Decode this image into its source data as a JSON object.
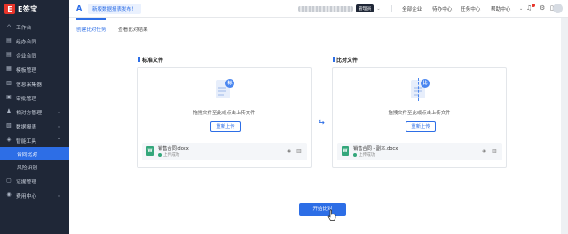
{
  "brand": {
    "logo_mark": "E",
    "name": "E签宝"
  },
  "sidebar": {
    "items": [
      {
        "label": "工作台",
        "icon": "home-icon"
      },
      {
        "label": "经办合同",
        "icon": "file-icon"
      },
      {
        "label": "企业合同",
        "icon": "file-icon"
      },
      {
        "label": "模板管理",
        "icon": "template-icon"
      },
      {
        "label": "信息采集器",
        "icon": "form-icon"
      },
      {
        "label": "审批管理",
        "icon": "approve-icon"
      },
      {
        "label": "相对方管理",
        "icon": "contacts-icon",
        "chevron": "⌄"
      },
      {
        "label": "数据报表",
        "icon": "chart-icon",
        "chevron": "⌄"
      },
      {
        "label": "智能工具",
        "icon": "tool-icon",
        "chevron": "⌃"
      }
    ],
    "sub_items": [
      {
        "label": "合同比对",
        "active": true
      },
      {
        "label": "风险识别",
        "active": false
      }
    ],
    "bottom_items": [
      {
        "label": "证据管理",
        "icon": "evidence-icon"
      },
      {
        "label": "费用中心",
        "icon": "fee-icon",
        "chevron": "⌄"
      }
    ]
  },
  "header": {
    "announcement": "新版数据报表发布！",
    "user_badge": "管理员",
    "enterprise": "全部企业",
    "todo": "待办中心",
    "tasks": "任务中心",
    "help": "帮助中心"
  },
  "tabs": [
    {
      "label": "创建比对任务",
      "active": true
    },
    {
      "label": "查看比对结果",
      "active": false
    }
  ],
  "standard": {
    "title": "标准文件",
    "badge": "标",
    "hint": "拖拽文件至此或点击上传文件",
    "reupload": "重新上传",
    "file_name": "销售合同.docx",
    "status": "上传成功",
    "file_type": "W"
  },
  "compare": {
    "title": "比对文件",
    "badge": "比",
    "hint": "拖拽文件至此或点击上传文件",
    "reupload": "重新上传",
    "file_name": "销售合同 - 副本.docx",
    "status": "上传成功",
    "file_type": "W"
  },
  "actions": {
    "start": "开始比对"
  },
  "colors": {
    "primary": "#2d6ee6",
    "sidebar_bg": "#1f2737",
    "success": "#34a77b"
  }
}
